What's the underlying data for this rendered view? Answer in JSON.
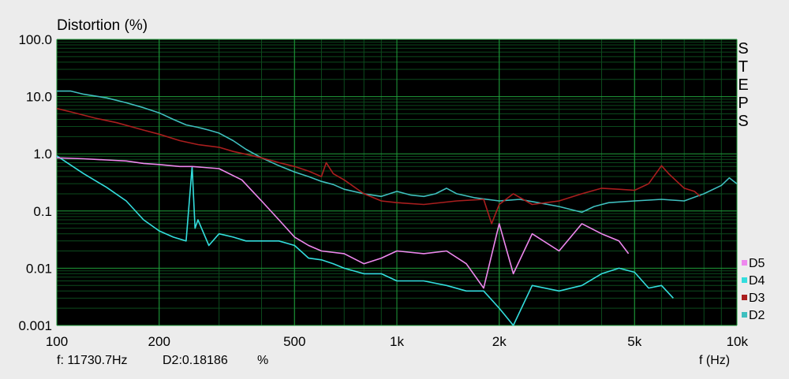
{
  "chart_data": {
    "type": "line",
    "title": "Distortion (%)",
    "xlabel": "f (Hz)",
    "ylabel": "Distortion (%)",
    "x_scale": "log",
    "y_scale": "log",
    "xlim": [
      100,
      10000
    ],
    "ylim": [
      0.001,
      100
    ],
    "x_ticks": [
      {
        "value": 100,
        "label": "100"
      },
      {
        "value": 200,
        "label": "200"
      },
      {
        "value": 500,
        "label": "500"
      },
      {
        "value": 1000,
        "label": "1k"
      },
      {
        "value": 2000,
        "label": "2k"
      },
      {
        "value": 5000,
        "label": "5k"
      },
      {
        "value": 10000,
        "label": "10k"
      }
    ],
    "y_ticks": [
      {
        "value": 100,
        "label": "100.0"
      },
      {
        "value": 10,
        "label": "10.0"
      },
      {
        "value": 1,
        "label": "1.0"
      },
      {
        "value": 0.1,
        "label": "0.1"
      },
      {
        "value": 0.01,
        "label": "0.01"
      },
      {
        "value": 0.001,
        "label": "0.001"
      }
    ],
    "grid": true,
    "background": "#000000",
    "grid_major_color": "#1f9d3a",
    "grid_minor_color": "#0c4a1d",
    "side_label": "STEPS",
    "legend_position": "right",
    "readout": {
      "freq": "f:  11730.7Hz",
      "value": "D2:0.18186",
      "unit": "%"
    },
    "series": [
      {
        "name": "D2",
        "color": "#3fbfbf",
        "points": [
          [
            100,
            12.5
          ],
          [
            110,
            12.5
          ],
          [
            120,
            11
          ],
          [
            140,
            9.5
          ],
          [
            160,
            7.8
          ],
          [
            180,
            6.4
          ],
          [
            200,
            5.2
          ],
          [
            220,
            4
          ],
          [
            240,
            3.2
          ],
          [
            260,
            2.9
          ],
          [
            280,
            2.6
          ],
          [
            300,
            2.3
          ],
          [
            330,
            1.7
          ],
          [
            360,
            1.2
          ],
          [
            400,
            0.85
          ],
          [
            450,
            0.62
          ],
          [
            500,
            0.48
          ],
          [
            550,
            0.4
          ],
          [
            600,
            0.33
          ],
          [
            650,
            0.29
          ],
          [
            700,
            0.24
          ],
          [
            800,
            0.2
          ],
          [
            900,
            0.18
          ],
          [
            1000,
            0.22
          ],
          [
            1100,
            0.19
          ],
          [
            1200,
            0.18
          ],
          [
            1300,
            0.2
          ],
          [
            1400,
            0.25
          ],
          [
            1500,
            0.2
          ],
          [
            1700,
            0.17
          ],
          [
            2000,
            0.15
          ],
          [
            2300,
            0.16
          ],
          [
            2600,
            0.14
          ],
          [
            3000,
            0.12
          ],
          [
            3500,
            0.095
          ],
          [
            3800,
            0.12
          ],
          [
            4200,
            0.14
          ],
          [
            5000,
            0.15
          ],
          [
            6000,
            0.16
          ],
          [
            7000,
            0.15
          ],
          [
            8000,
            0.2
          ],
          [
            9000,
            0.28
          ],
          [
            9500,
            0.38
          ],
          [
            10000,
            0.3
          ]
        ]
      },
      {
        "name": "D3",
        "color": "#aa1e1e",
        "points": [
          [
            100,
            6.2
          ],
          [
            110,
            5.4
          ],
          [
            130,
            4.2
          ],
          [
            150,
            3.5
          ],
          [
            180,
            2.6
          ],
          [
            200,
            2.2
          ],
          [
            230,
            1.7
          ],
          [
            260,
            1.45
          ],
          [
            300,
            1.3
          ],
          [
            330,
            1.1
          ],
          [
            360,
            0.98
          ],
          [
            400,
            0.85
          ],
          [
            450,
            0.7
          ],
          [
            500,
            0.6
          ],
          [
            550,
            0.5
          ],
          [
            600,
            0.4
          ],
          [
            620,
            0.7
          ],
          [
            650,
            0.45
          ],
          [
            700,
            0.35
          ],
          [
            800,
            0.2
          ],
          [
            900,
            0.15
          ],
          [
            1000,
            0.14
          ],
          [
            1200,
            0.13
          ],
          [
            1500,
            0.15
          ],
          [
            1800,
            0.16
          ],
          [
            1900,
            0.06
          ],
          [
            2000,
            0.13
          ],
          [
            2200,
            0.2
          ],
          [
            2500,
            0.13
          ],
          [
            3000,
            0.15
          ],
          [
            3500,
            0.2
          ],
          [
            4000,
            0.25
          ],
          [
            4500,
            0.24
          ],
          [
            5000,
            0.23
          ],
          [
            5500,
            0.3
          ],
          [
            6000,
            0.62
          ],
          [
            6300,
            0.45
          ],
          [
            7000,
            0.25
          ],
          [
            7500,
            0.22
          ],
          [
            7800,
            0.18
          ]
        ]
      },
      {
        "name": "D4",
        "color": "#33dddd",
        "points": [
          [
            100,
            0.92
          ],
          [
            120,
            0.45
          ],
          [
            140,
            0.26
          ],
          [
            160,
            0.15
          ],
          [
            180,
            0.07
          ],
          [
            200,
            0.045
          ],
          [
            220,
            0.035
          ],
          [
            240,
            0.03
          ],
          [
            250,
            0.6
          ],
          [
            255,
            0.05
          ],
          [
            260,
            0.07
          ],
          [
            280,
            0.025
          ],
          [
            300,
            0.04
          ],
          [
            330,
            0.035
          ],
          [
            360,
            0.03
          ],
          [
            400,
            0.03
          ],
          [
            450,
            0.03
          ],
          [
            500,
            0.025
          ],
          [
            550,
            0.015
          ],
          [
            600,
            0.014
          ],
          [
            650,
            0.012
          ],
          [
            700,
            0.01
          ],
          [
            800,
            0.008
          ],
          [
            900,
            0.008
          ],
          [
            1000,
            0.006
          ],
          [
            1200,
            0.006
          ],
          [
            1400,
            0.005
          ],
          [
            1600,
            0.004
          ],
          [
            1800,
            0.004
          ],
          [
            2000,
            0.002
          ],
          [
            2200,
            0.001
          ],
          [
            2500,
            0.005
          ],
          [
            3000,
            0.004
          ],
          [
            3500,
            0.005
          ],
          [
            4000,
            0.008
          ],
          [
            4500,
            0.01
          ],
          [
            5000,
            0.0085
          ],
          [
            5500,
            0.0045
          ],
          [
            6000,
            0.005
          ],
          [
            6500,
            0.003
          ]
        ]
      },
      {
        "name": "D5",
        "color": "#ee88ee",
        "points": [
          [
            100,
            0.85
          ],
          [
            120,
            0.82
          ],
          [
            140,
            0.78
          ],
          [
            160,
            0.75
          ],
          [
            180,
            0.68
          ],
          [
            200,
            0.65
          ],
          [
            230,
            0.6
          ],
          [
            250,
            0.6
          ],
          [
            300,
            0.55
          ],
          [
            350,
            0.35
          ],
          [
            400,
            0.15
          ],
          [
            450,
            0.07
          ],
          [
            500,
            0.035
          ],
          [
            550,
            0.025
          ],
          [
            600,
            0.02
          ],
          [
            700,
            0.018
          ],
          [
            800,
            0.012
          ],
          [
            900,
            0.015
          ],
          [
            1000,
            0.02
          ],
          [
            1200,
            0.018
          ],
          [
            1400,
            0.02
          ],
          [
            1600,
            0.012
          ],
          [
            1800,
            0.0045
          ],
          [
            2000,
            0.06
          ],
          [
            2200,
            0.008
          ],
          [
            2500,
            0.04
          ],
          [
            3000,
            0.02
          ],
          [
            3500,
            0.06
          ],
          [
            4000,
            0.04
          ],
          [
            4500,
            0.03
          ],
          [
            4800,
            0.018
          ]
        ]
      }
    ]
  }
}
